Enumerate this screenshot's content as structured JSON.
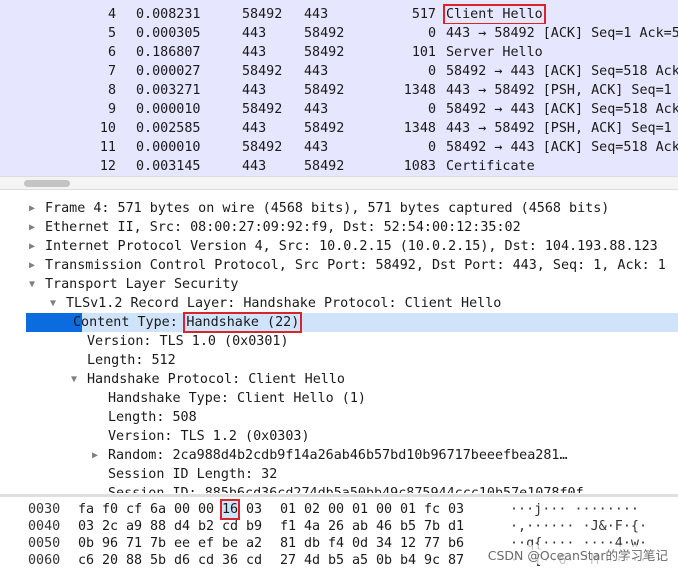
{
  "packet_list": {
    "rows": [
      {
        "no": "4",
        "time": "0.008231",
        "src": "58492",
        "dst": "443",
        "len": "517",
        "info": "Client Hello",
        "boxed": true
      },
      {
        "no": "5",
        "time": "0.000305",
        "src": "443",
        "dst": "58492",
        "len": "0",
        "info": "443 → 58492 [ACK] Seq=1 Ack=5"
      },
      {
        "no": "6",
        "time": "0.186807",
        "src": "443",
        "dst": "58492",
        "len": "101",
        "info": "Server Hello"
      },
      {
        "no": "7",
        "time": "0.000027",
        "src": "58492",
        "dst": "443",
        "len": "0",
        "info": "58492 → 443 [ACK] Seq=518 Ack"
      },
      {
        "no": "8",
        "time": "0.003271",
        "src": "443",
        "dst": "58492",
        "len": "1348",
        "info": "443 → 58492 [PSH, ACK] Seq=1"
      },
      {
        "no": "9",
        "time": "0.000010",
        "src": "58492",
        "dst": "443",
        "len": "0",
        "info": "58492 → 443 [ACK] Seq=518 Ack"
      },
      {
        "no": "10",
        "time": "0.002585",
        "src": "443",
        "dst": "58492",
        "len": "1348",
        "info": "443 → 58492 [PSH, ACK] Seq=1"
      },
      {
        "no": "11",
        "time": "0.000010",
        "src": "58492",
        "dst": "443",
        "len": "0",
        "info": "58492 → 443 [ACK] Seq=518 Ack"
      },
      {
        "no": "12",
        "time": "0.003145",
        "src": "443",
        "dst": "58492",
        "len": "1083",
        "info": "Certificate"
      }
    ]
  },
  "details": {
    "rows": [
      {
        "indent": 0,
        "tri": "right",
        "text": "Frame 4: 571 bytes on wire (4568 bits), 571 bytes captured (4568 bits)"
      },
      {
        "indent": 0,
        "tri": "right",
        "text": "Ethernet II, Src: 08:00:27:09:92:f9, Dst: 52:54:00:12:35:02"
      },
      {
        "indent": 0,
        "tri": "right",
        "text": "Internet Protocol Version 4, Src: 10.0.2.15 (10.0.2.15), Dst: 104.193.88.123"
      },
      {
        "indent": 0,
        "tri": "right",
        "text": "Transmission Control Protocol, Src Port: 58492, Dst Port: 443, Seq: 1, Ack: 1"
      },
      {
        "indent": 0,
        "tri": "down",
        "text": "Transport Layer Security"
      },
      {
        "indent": 1,
        "tri": "down",
        "text": "TLSv1.2 Record Layer: Handshake Protocol: Client Hello"
      },
      {
        "indent": 2,
        "tri": "none",
        "label": "Content Type: ",
        "boxed": "Handshake (22)",
        "selected": true
      },
      {
        "indent": 2,
        "tri": "none",
        "text": "Version: TLS 1.0 (0x0301)"
      },
      {
        "indent": 2,
        "tri": "none",
        "text": "Length: 512"
      },
      {
        "indent": 2,
        "tri": "down",
        "text": "Handshake Protocol: Client Hello"
      },
      {
        "indent": 3,
        "tri": "none",
        "text": "Handshake Type: Client Hello (1)"
      },
      {
        "indent": 3,
        "tri": "none",
        "text": "Length: 508"
      },
      {
        "indent": 3,
        "tri": "none",
        "text": "Version: TLS 1.2 (0x0303)"
      },
      {
        "indent": 3,
        "tri": "right",
        "text": "Random: 2ca988d4b2cdb9f14a26ab46b57bd10b96717beeefbea281…"
      },
      {
        "indent": 3,
        "tri": "none",
        "text": "Session ID Length: 32"
      },
      {
        "indent": 3,
        "tri": "none",
        "text": "Session ID: 885b6cd36cd274db5a50bb49c875944ccc10b57e1078f0f"
      }
    ]
  },
  "bytes": {
    "rows": [
      {
        "offset": "0030",
        "hex": [
          "fa",
          "f0",
          "cf",
          "6a",
          "00",
          "00",
          "16",
          "03",
          "01",
          "02",
          "00",
          "01",
          "00",
          "01",
          "fc",
          "03"
        ],
        "ascii": "···j··· ········",
        "hl_index": 6
      },
      {
        "offset": "0040",
        "hex": [
          "03",
          "2c",
          "a9",
          "88",
          "d4",
          "b2",
          "cd",
          "b9",
          "f1",
          "4a",
          "26",
          "ab",
          "46",
          "b5",
          "7b",
          "d1"
        ],
        "ascii": "·,······ ·J&·F·{·"
      },
      {
        "offset": "0050",
        "hex": [
          "0b",
          "96",
          "71",
          "7b",
          "ee",
          "ef",
          "be",
          "a2",
          "81",
          "db",
          "f4",
          "0d",
          "34",
          "12",
          "77",
          "b6"
        ],
        "ascii": "··q{···· ····4·w·"
      },
      {
        "offset": "0060",
        "hex": [
          "c6",
          "20",
          "88",
          "5b",
          "d6",
          "cd",
          "36",
          "cd",
          "27",
          "4d",
          "b5",
          "a5",
          "0b",
          "b4",
          "9c",
          "87"
        ],
        "ascii": "· ·[··6· 'M······"
      }
    ]
  },
  "watermark": "CSDN @OceanStar的学习笔记",
  "colors": {
    "list_bg": "#e7e6ff",
    "selected_bg": "#cfe4fb",
    "select_marker": "#0b6cdf",
    "highlight_box": "#d6252b"
  }
}
